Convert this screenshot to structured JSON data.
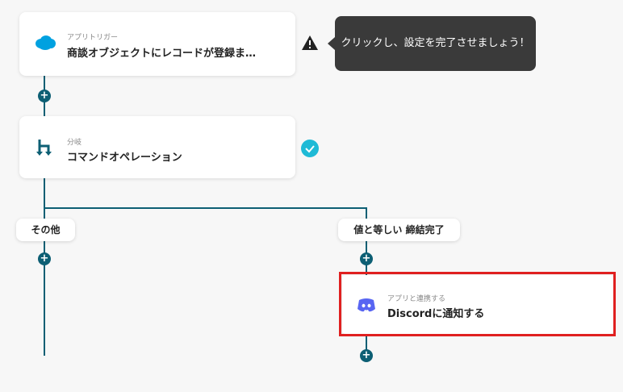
{
  "flow": {
    "trigger": {
      "sub": "アプリトリガー",
      "title": "商談オブジェクトにレコードが登録ま…",
      "icon": "salesforce-cloud-icon",
      "warning_icon": "warning-triangle-icon"
    },
    "tooltip": "クリックし、設定を完了させましょう！",
    "branch": {
      "sub": "分岐",
      "title": "コマンドオペレーション",
      "icon": "branch-icon",
      "status_icon": "check-circle-icon"
    },
    "branches": {
      "left_label": "その他",
      "right_label": "値と等しい 締結完了"
    },
    "action": {
      "sub": "アプリと連携する",
      "title": "Discordに通知する",
      "icon": "discord-icon"
    },
    "plus_symbol": "+"
  },
  "colors": {
    "line": "#0d5f74",
    "salesforce": "#00a1e0",
    "discord": "#5865f2",
    "check": "#1fbad6",
    "highlight": "#e02020"
  }
}
